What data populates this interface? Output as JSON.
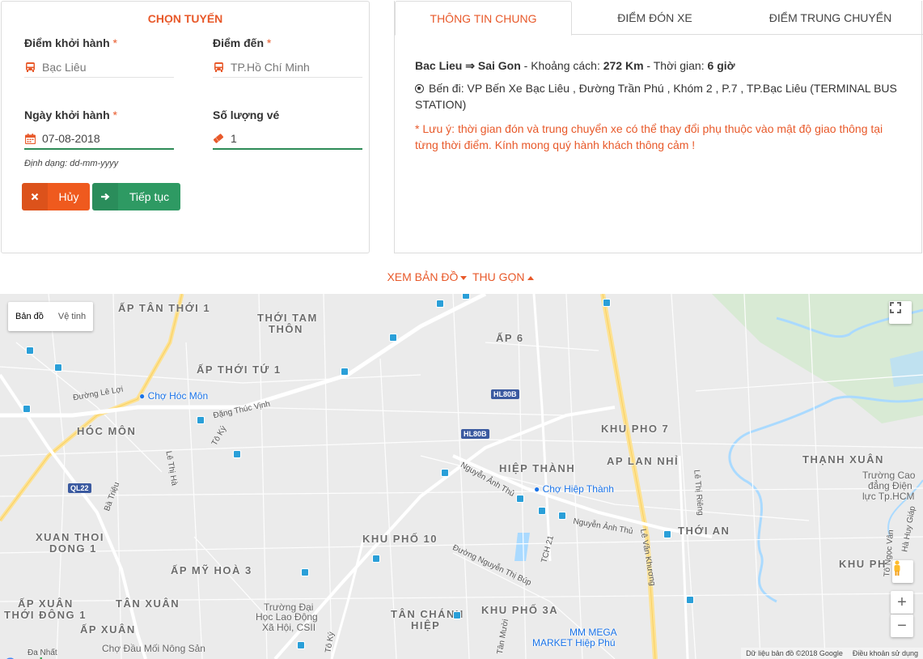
{
  "booking": {
    "title": "CHỌN TUYẾN",
    "from_label": "Điểm khởi hành",
    "from_value": "Bạc Liêu",
    "to_label": "Điểm đến",
    "to_value": "TP.Hồ Chí Minh",
    "date_label": "Ngày khởi hành",
    "date_value": "07-08-2018",
    "date_hint": "Định dạng: dd-mm-yyyy",
    "qty_label": "Số lượng vé",
    "qty_value": "1",
    "required_mark": "*",
    "cancel_label": "Hủy",
    "next_label": "Tiếp tục"
  },
  "tabs": [
    {
      "label": "THÔNG TIN CHUNG",
      "active": true
    },
    {
      "label": "ĐIỂM ĐÓN XE",
      "active": false
    },
    {
      "label": "ĐIỂM TRUNG CHUYỂN",
      "active": false
    }
  ],
  "info": {
    "route_from": "Bac Lieu",
    "arrow": "⇒",
    "route_to": "Sai Gon",
    "distance_label": " - Khoảng cách: ",
    "distance": "272 Km",
    "time_label": " - Thời gian: ",
    "time": "6 giờ",
    "depart_text": "Bến đi: VP Bến Xe Bạc Liêu , Đường Trần Phú , Khóm 2 , P.7 , TP.Bạc Liêu (TERMINAL BUS STATION)",
    "note_text": "* Lưu ý: thời gian đón và trung chuyển xe có thể thay đổi phụ thuộc vào mật độ giao thông tại từng thời điểm. Kính mong quý hành khách thông cảm !"
  },
  "map_toggle": {
    "show_label": "XEM BẢN ĐỒ",
    "collapse_label": "THU GỌN"
  },
  "map": {
    "type_map": "Bản đồ",
    "type_sat": "Vệ tinh",
    "zoom_in": "+",
    "zoom_out": "−",
    "footer_data": "Dữ liệu bản đồ ©2018 Google",
    "footer_terms": "Điều khoản sử dụng",
    "areas": [
      "ẤP TÂN THỚI 1",
      "THỚI TAM",
      "THÔN",
      "ẤP 6",
      "ẤP THỚI TỨ 1",
      "HÓC MÔN",
      "KHU PHO 7",
      "HIỆP THÀNH",
      "AP LAN NHỈ",
      "THẠNH XUÂN",
      "XUAN THOI",
      "DONG 1",
      "THỚI AN",
      "KHU PHỐ 10",
      "ẤP MỸ HOÀ 3",
      "ẤP XUÂN",
      "THỚI ĐÔNG 1",
      "TÂN XUÂN",
      "ẤP XUÂN",
      "TÂN CHÁNH",
      "HIỆP",
      "KHU PHỐ 3A",
      "KHU PH"
    ],
    "pois": [
      "Chợ Hóc Môn",
      "Chợ Hiệp Thành",
      "MM MEGA",
      "MARKET Hiệp Phú"
    ],
    "grey_pois": [
      "Trường Cao",
      "đẳng Điện",
      "lực Tp.HCM",
      "Trường Đại",
      "Học Lao Động",
      "Xã Hội, CSII",
      "Chợ Đầu Mối Nông Sản"
    ],
    "streets": [
      "Đường Lê Lợi",
      "Đặng Thúc Vịnh",
      "Tô Ký",
      "Lê Thị Hà",
      "Bà Triệu",
      "Nguyễn Ảnh Thủ",
      "Nguyễn Ảnh Thủ",
      "Lê Văn Khương",
      "Lê Thị Riêng",
      "TCH 21",
      "Đường Nguyễn Thị Búp",
      "Tô Ký",
      "Tô Ngọc Vân",
      "Hà Huy Giáp",
      "Tân Mười",
      "Đa Nhất"
    ],
    "road_tags": [
      "HL80B",
      "HL80B",
      "QL22"
    ]
  },
  "colors": {
    "accent": "#e8592a",
    "cancel": "#ef5a1e",
    "next": "#2e9a63",
    "active_underline": "#2e8b57"
  }
}
